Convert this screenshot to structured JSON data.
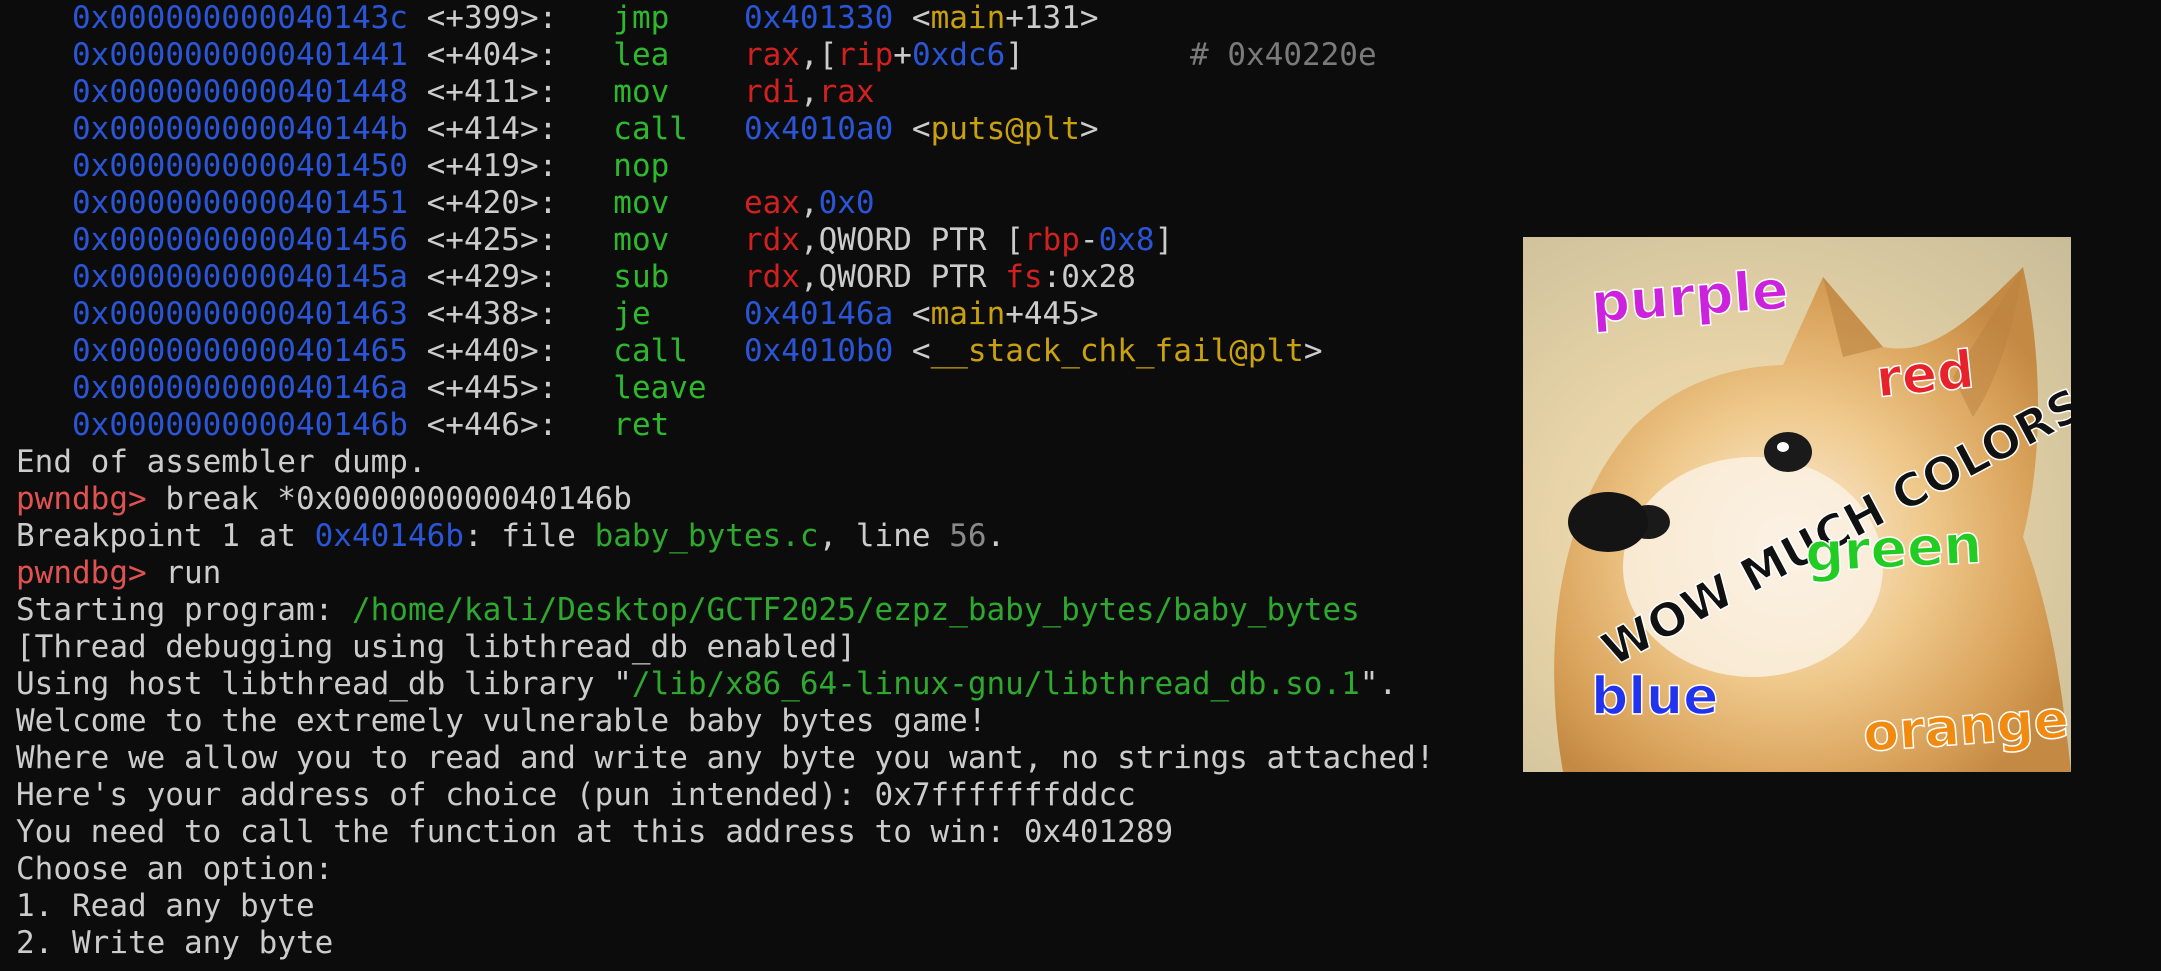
{
  "terminal": {
    "disasm": [
      {
        "addr": "0x000000000040143c",
        "off": "<+399>:",
        "op": "jmp",
        "args": [
          {
            "t": "0x401330",
            "c": "num"
          },
          {
            "t": " <",
            "c": "plain"
          },
          {
            "t": "main",
            "c": "sym"
          },
          {
            "t": "+131>",
            "c": "plain"
          }
        ],
        "comment": ""
      },
      {
        "addr": "0x0000000000401441",
        "off": "<+404>:",
        "op": "lea",
        "args": [
          {
            "t": "rax",
            "c": "reg"
          },
          {
            "t": ",[",
            "c": "plain"
          },
          {
            "t": "rip",
            "c": "reg"
          },
          {
            "t": "+",
            "c": "plain"
          },
          {
            "t": "0xdc6",
            "c": "num"
          },
          {
            "t": "]",
            "c": "plain"
          }
        ],
        "comment": "# 0x40220e"
      },
      {
        "addr": "0x0000000000401448",
        "off": "<+411>:",
        "op": "mov",
        "args": [
          {
            "t": "rdi",
            "c": "reg"
          },
          {
            "t": ",",
            "c": "plain"
          },
          {
            "t": "rax",
            "c": "reg"
          }
        ],
        "comment": ""
      },
      {
        "addr": "0x000000000040144b",
        "off": "<+414>:",
        "op": "call",
        "args": [
          {
            "t": "0x4010a0",
            "c": "num"
          },
          {
            "t": " <",
            "c": "plain"
          },
          {
            "t": "puts@plt",
            "c": "sym"
          },
          {
            "t": ">",
            "c": "plain"
          }
        ],
        "comment": ""
      },
      {
        "addr": "0x0000000000401450",
        "off": "<+419>:",
        "op": "nop",
        "args": [],
        "comment": ""
      },
      {
        "addr": "0x0000000000401451",
        "off": "<+420>:",
        "op": "mov",
        "args": [
          {
            "t": "eax",
            "c": "reg"
          },
          {
            "t": ",",
            "c": "plain"
          },
          {
            "t": "0x0",
            "c": "num"
          }
        ],
        "comment": ""
      },
      {
        "addr": "0x0000000000401456",
        "off": "<+425>:",
        "op": "mov",
        "args": [
          {
            "t": "rdx",
            "c": "reg"
          },
          {
            "t": ",QWORD PTR [",
            "c": "plain"
          },
          {
            "t": "rbp",
            "c": "reg"
          },
          {
            "t": "-",
            "c": "plain"
          },
          {
            "t": "0x8",
            "c": "num"
          },
          {
            "t": "]",
            "c": "plain"
          }
        ],
        "comment": ""
      },
      {
        "addr": "0x000000000040145a",
        "off": "<+429>:",
        "op": "sub",
        "args": [
          {
            "t": "rdx",
            "c": "reg"
          },
          {
            "t": ",QWORD PTR ",
            "c": "plain"
          },
          {
            "t": "fs",
            "c": "reg"
          },
          {
            "t": ":0x28",
            "c": "plain"
          }
        ],
        "comment": ""
      },
      {
        "addr": "0x0000000000401463",
        "off": "<+438>:",
        "op": "je",
        "args": [
          {
            "t": "0x40146a",
            "c": "num"
          },
          {
            "t": " <",
            "c": "plain"
          },
          {
            "t": "main",
            "c": "sym"
          },
          {
            "t": "+445>",
            "c": "plain"
          }
        ],
        "comment": ""
      },
      {
        "addr": "0x0000000000401465",
        "off": "<+440>:",
        "op": "call",
        "args": [
          {
            "t": "0x4010b0",
            "c": "num"
          },
          {
            "t": " <",
            "c": "plain"
          },
          {
            "t": "__stack_chk_fail@plt",
            "c": "sym"
          },
          {
            "t": ">",
            "c": "plain"
          }
        ],
        "comment": ""
      },
      {
        "addr": "0x000000000040146a",
        "off": "<+445>:",
        "op": "leave",
        "args": [],
        "comment": ""
      },
      {
        "addr": "0x000000000040146b",
        "off": "<+446>:",
        "op": "ret",
        "args": [],
        "comment": ""
      }
    ],
    "output": [
      [
        {
          "t": "End of assembler dump.",
          "c": "plain"
        }
      ],
      [
        {
          "t": "pwndbg>",
          "c": "prompt"
        },
        {
          "t": " break *0x000000000040146b",
          "c": "plain"
        }
      ],
      [
        {
          "t": "Breakpoint 1 at ",
          "c": "plain"
        },
        {
          "t": "0x40146b",
          "c": "num"
        },
        {
          "t": ": file ",
          "c": "plain"
        },
        {
          "t": "baby_bytes.c",
          "c": "path"
        },
        {
          "t": ", line ",
          "c": "plain"
        },
        {
          "t": "56",
          "c": "gray"
        },
        {
          "t": ".",
          "c": "plain"
        }
      ],
      [
        {
          "t": "pwndbg>",
          "c": "prompt"
        },
        {
          "t": " run",
          "c": "plain"
        }
      ],
      [
        {
          "t": "Starting program: ",
          "c": "plain"
        },
        {
          "t": "/home/kali/Desktop/GCTF2025/ezpz_baby_bytes/baby_bytes",
          "c": "path"
        }
      ],
      [
        {
          "t": "[Thread debugging using libthread_db enabled]",
          "c": "plain"
        }
      ],
      [
        {
          "t": "Using host libthread_db library \"",
          "c": "plain"
        },
        {
          "t": "/lib/x86_64-linux-gnu/libthread_db.so.1",
          "c": "path"
        },
        {
          "t": "\".",
          "c": "plain"
        }
      ],
      [
        {
          "t": "Welcome to the extremely vulnerable baby bytes game!",
          "c": "plain"
        }
      ],
      [
        {
          "t": "Where we allow you to read and write any byte you want, no strings attached!",
          "c": "plain"
        }
      ],
      [
        {
          "t": "Here's your address of choice (pun intended): 0x7fffffffddcc",
          "c": "plain"
        }
      ],
      [
        {
          "t": "You need to call the function at this address to win: 0x401289",
          "c": "plain"
        }
      ],
      [
        {
          "t": "Choose an option:",
          "c": "plain"
        }
      ],
      [
        {
          "t": "1. Read any byte",
          "c": "plain"
        }
      ],
      [
        {
          "t": "2. Write any byte",
          "c": "plain"
        }
      ]
    ]
  },
  "meme": {
    "words": {
      "purple": "purple",
      "red": "red",
      "caption": "WOW MUCH COLORS",
      "green": "green",
      "blue": "blue",
      "orange": "orange"
    }
  },
  "colors": {
    "background": "#0c0c0c",
    "address": "#2a55d6",
    "opcode": "#2eb82e",
    "register": "#d02020",
    "symbol": "#c9a10f",
    "prompt": "#e05252",
    "path": "#2ea82e"
  }
}
